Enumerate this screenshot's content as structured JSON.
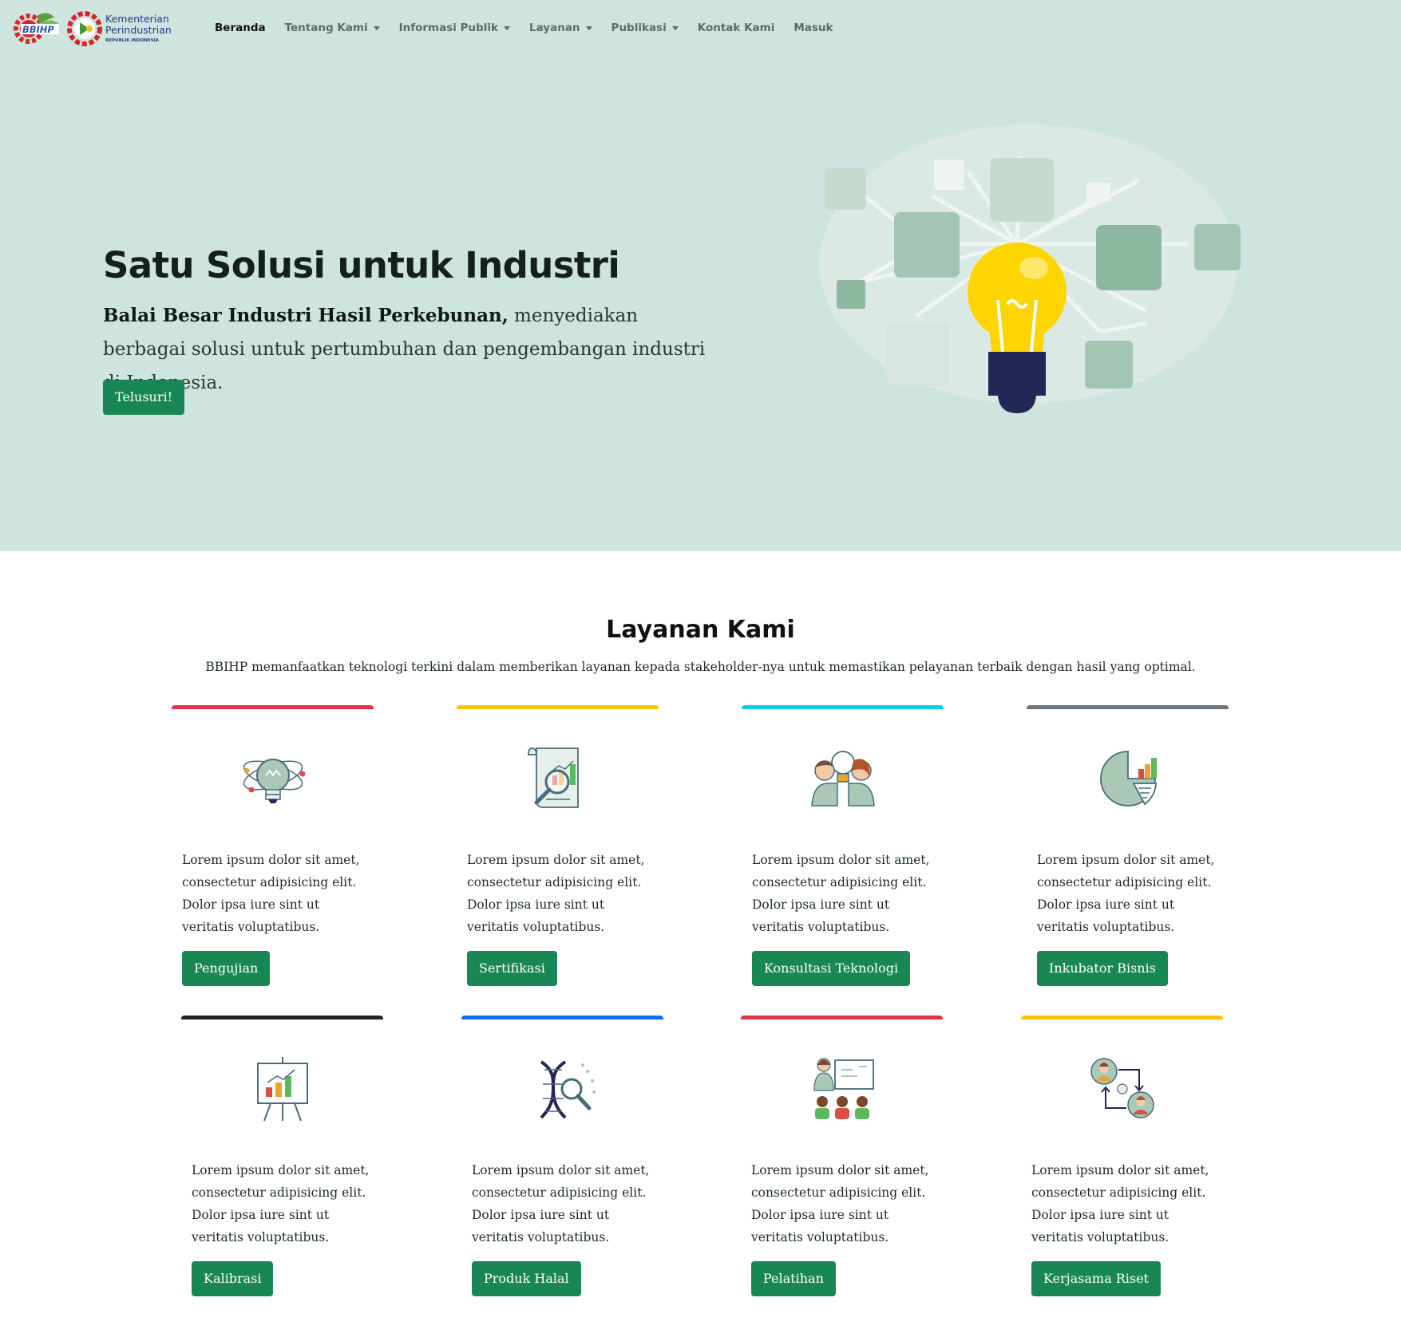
{
  "brand": {
    "logo_text": "BBIHP",
    "ministry_line1": "Kementerian",
    "ministry_line2": "Perindustrian",
    "ministry_line3": "REPUBLIK INDONESIA"
  },
  "nav": {
    "items": [
      {
        "label": "Beranda",
        "active": true,
        "dropdown": false
      },
      {
        "label": "Tentang Kami",
        "active": false,
        "dropdown": true
      },
      {
        "label": "Informasi Publik",
        "active": false,
        "dropdown": true
      },
      {
        "label": "Layanan",
        "active": false,
        "dropdown": true
      },
      {
        "label": "Publikasi",
        "active": false,
        "dropdown": true
      },
      {
        "label": "Kontak Kami",
        "active": false,
        "dropdown": false
      },
      {
        "label": "Masuk",
        "active": false,
        "dropdown": false
      }
    ]
  },
  "hero": {
    "title": "Satu Solusi untuk Industri",
    "subtitle_bold": "Balai Besar Industri Hasil Perkebunan,",
    "subtitle_rest": " menyediakan berbagai solusi untuk pertumbuhan dan pengembangan industri di Indonesia.",
    "button_label": "Telusuri!"
  },
  "services": {
    "title": "Layanan Kami",
    "description": "BBIHP memanfaatkan teknologi terkini dalam memberikan layanan kepada stakeholder-nya untuk memastikan pelayanan terbaik dengan hasil yang optimal.",
    "cards": [
      {
        "icon": "lightbulb-atom-icon",
        "text": "Lorem ipsum dolor sit amet, consectetur adipisicing elit. Dolor ipsa iure sint ut veritatis voluptatibus.",
        "button": "Pengujian",
        "color": "#dc3545"
      },
      {
        "icon": "document-analysis-icon",
        "text": "Lorem ipsum dolor sit amet, consectetur adipisicing elit. Dolor ipsa iure sint ut veritatis voluptatibus.",
        "button": "Sertifikasi",
        "color": "#ffc107"
      },
      {
        "icon": "consultation-people-icon",
        "text": "Lorem ipsum dolor sit amet, consectetur adipisicing elit. Dolor ipsa iure sint ut veritatis voluptatibus.",
        "button": "Konsultasi Teknologi",
        "color": "#0dcaf0"
      },
      {
        "icon": "pie-chart-icon",
        "text": "Lorem ipsum dolor sit amet, consectetur adipisicing elit. Dolor ipsa iure sint ut veritatis voluptatibus.",
        "button": "Inkubator Bisnis",
        "color": "#6c757d"
      },
      {
        "icon": "presentation-board-icon",
        "text": "Lorem ipsum dolor sit amet, consectetur adipisicing elit. Dolor ipsa iure sint ut veritatis voluptatibus.",
        "button": "Kalibrasi",
        "color": "#212529"
      },
      {
        "icon": "dna-search-icon",
        "text": "Lorem ipsum dolor sit amet, consectetur adipisicing elit. Dolor ipsa iure sint ut veritatis voluptatibus.",
        "button": "Produk Halal",
        "color": "#0d6efd"
      },
      {
        "icon": "training-class-icon",
        "text": "Lorem ipsum dolor sit amet, consectetur adipisicing elit. Dolor ipsa iure sint ut veritatis voluptatibus.",
        "button": "Pelatihan",
        "color": "#dc3545"
      },
      {
        "icon": "collaboration-exchange-icon",
        "text": "Lorem ipsum dolor sit amet, consectetur adipisicing elit. Dolor ipsa iure sint ut veritatis voluptatibus.",
        "button": "Kerjasama Riset",
        "color": "#ffc107"
      }
    ]
  }
}
